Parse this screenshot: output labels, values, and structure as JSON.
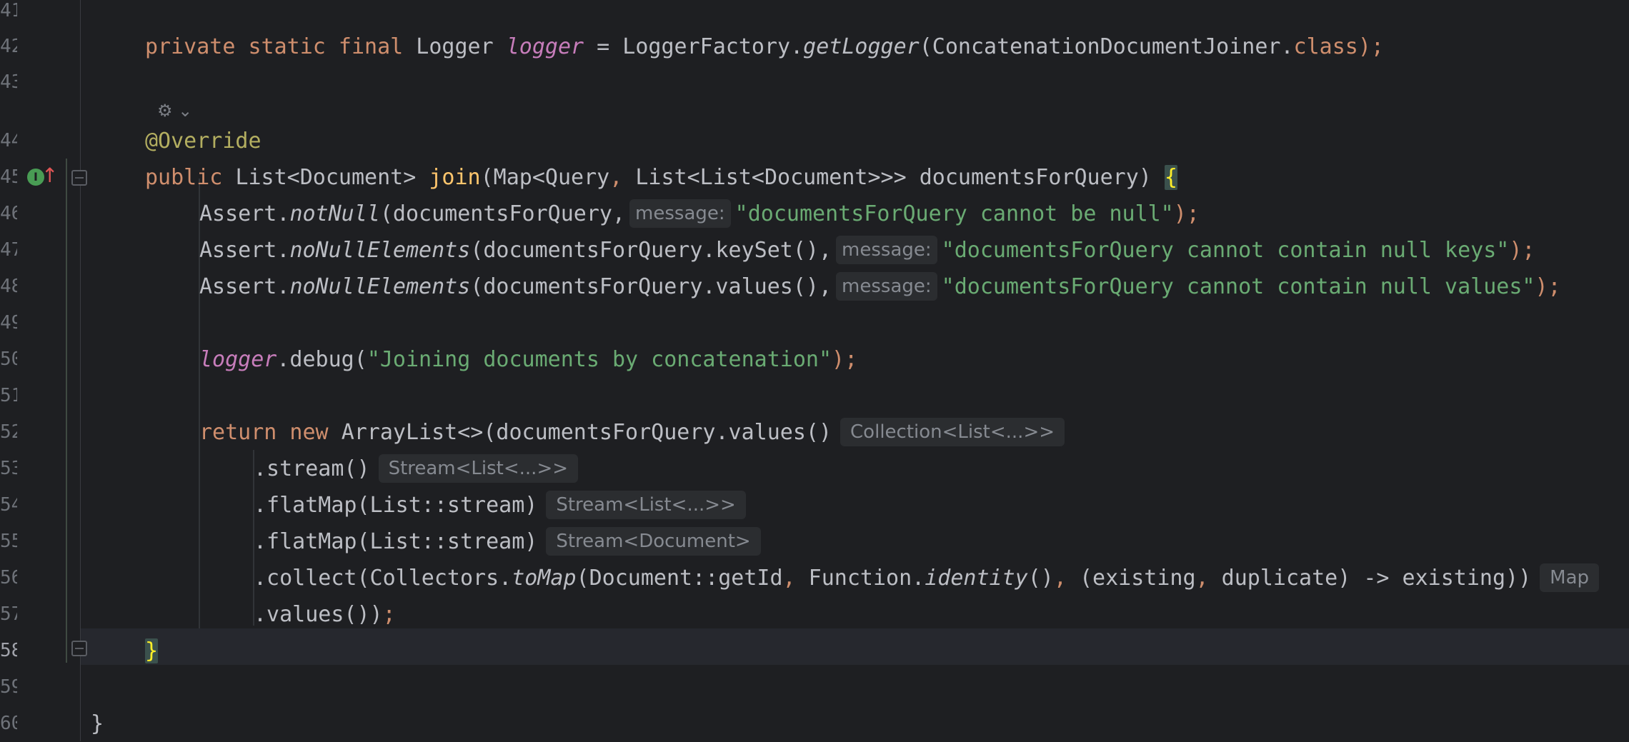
{
  "line_numbers": [
    "41",
    "42",
    "43",
    "44",
    "45",
    "46",
    "47",
    "48",
    "49",
    "50",
    "51",
    "52",
    "53",
    "54",
    "55",
    "56",
    "57",
    "58",
    "59",
    "60"
  ],
  "gutter_icons": {
    "override": "override-icon",
    "override_arrow": "up-arrow-icon",
    "fold": "fold-icon"
  },
  "code": {
    "l42": {
      "kw": "private static final ",
      "type": "Logger ",
      "field": "logger",
      "assign": " = LoggerFactory.",
      "method": "getLogger",
      "arg": "(ConcatenationDocumentJoiner.",
      "cls": "class",
      "end": ");"
    },
    "ai_widget": {
      "icon": "ai-assistant-icon",
      "chevron": "⌄"
    },
    "l44": {
      "annotation": "@Override"
    },
    "l45": {
      "kw": "public ",
      "ret": "List<Document> ",
      "name": "join",
      "params_a": "(Map<Query",
      "comma": ",",
      "params_b": " List<List<Document>>> documentsForQuery) ",
      "brace": "{"
    },
    "l46": {
      "obj": "Assert.",
      "method": "notNull",
      "args": "(documentsForQuery,",
      "hint": "message:",
      "str": "\"documentsForQuery cannot be null\"",
      "end": ");"
    },
    "l47": {
      "obj": "Assert.",
      "method": "noNullElements",
      "args": "(documentsForQuery.keySet(),",
      "hint": "message:",
      "str": "\"documentsForQuery cannot contain null keys\"",
      "end": ");"
    },
    "l48": {
      "obj": "Assert.",
      "method": "noNullElements",
      "args": "(documentsForQuery.values(),",
      "hint": "message:",
      "str": "\"documentsForQuery cannot contain null values\"",
      "end": ");"
    },
    "l50": {
      "field": "logger",
      "call": ".debug(",
      "str": "\"Joining documents by concatenation\"",
      "end": ");"
    },
    "l52": {
      "kw": "return new ",
      "call": "ArrayList<>(documentsForQuery.values()",
      "type_hint": "Collection<List<...>>"
    },
    "l53": {
      "call": ".stream()",
      "type_hint": "Stream<List<...>>"
    },
    "l54": {
      "call": ".flatMap(List::stream)",
      "type_hint": "Stream<List<...>>"
    },
    "l55": {
      "call": ".flatMap(List::stream)",
      "type_hint": "Stream<Document>"
    },
    "l56": {
      "a": ".collect(Collectors.",
      "method": "toMap",
      "b": "(Document::getId",
      "c1": ",",
      "d": " Function.",
      "method2": "identity",
      "e": "()",
      "c2": ",",
      "f": " (existing",
      "c3": ",",
      "g": " duplicate) -> existing))",
      "type_hint": "Map"
    },
    "l57": {
      "call": ".values())",
      "end": ";"
    },
    "l58": {
      "brace": "}"
    },
    "l60": {
      "brace": "}"
    }
  },
  "colors": {
    "background": "#1e1f22",
    "keyword": "#cf8e6d",
    "string": "#6aab73",
    "annotation": "#b3ae60",
    "field": "#c77dbb",
    "method_decl": "#ffc66d"
  }
}
